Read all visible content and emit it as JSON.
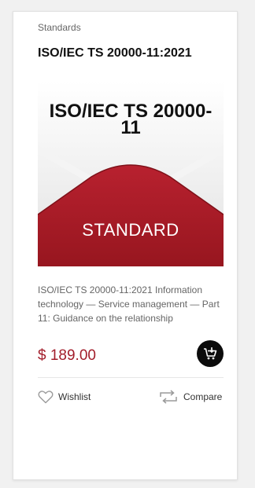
{
  "product": {
    "category": "Standards",
    "title": "ISO/IEC TS 20000-11:2021",
    "cover": {
      "title_line1": "ISO/IEC TS 20000-",
      "title_line2": "11",
      "label": "STANDARD"
    },
    "description": "ISO/IEC TS 20000-11:2021 Information technology — Service management — Part 11: Guidance on the relationship",
    "price": "$ 189.00",
    "actions": {
      "wishlist_label": "Wishlist",
      "compare_label": "Compare"
    }
  },
  "icons": {
    "cart": "add-to-cart-icon",
    "wishlist": "heart-icon",
    "compare": "repeat-arrows-icon"
  },
  "colors": {
    "price": "#a21d2a",
    "cover_red": "#a51c28",
    "cart_button": "#0c0c0c"
  }
}
